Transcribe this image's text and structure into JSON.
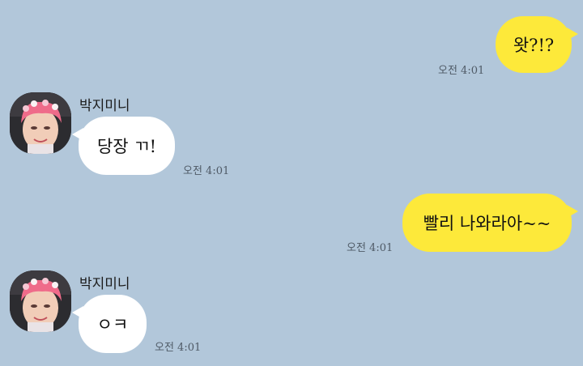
{
  "contact": {
    "name": "박지미니"
  },
  "messages": [
    {
      "from": "me",
      "text": "왓?!?",
      "time": "오전 4:01"
    },
    {
      "from": "them",
      "sender": "박지미니",
      "text": "당장 ㄲ!",
      "time": "오전 4:01"
    },
    {
      "from": "me",
      "text": "빨리 나와라아~~",
      "time": "오전 4:01"
    },
    {
      "from": "them",
      "sender": "박지미니",
      "text": "ㅇㅋ",
      "time": "오전 4:01"
    }
  ],
  "colors": {
    "background": "#b2c7da",
    "my_bubble": "#fde93a",
    "their_bubble": "#ffffff"
  },
  "avatar": {
    "icon": "profile-photo-pink-hair-flower-crown"
  }
}
